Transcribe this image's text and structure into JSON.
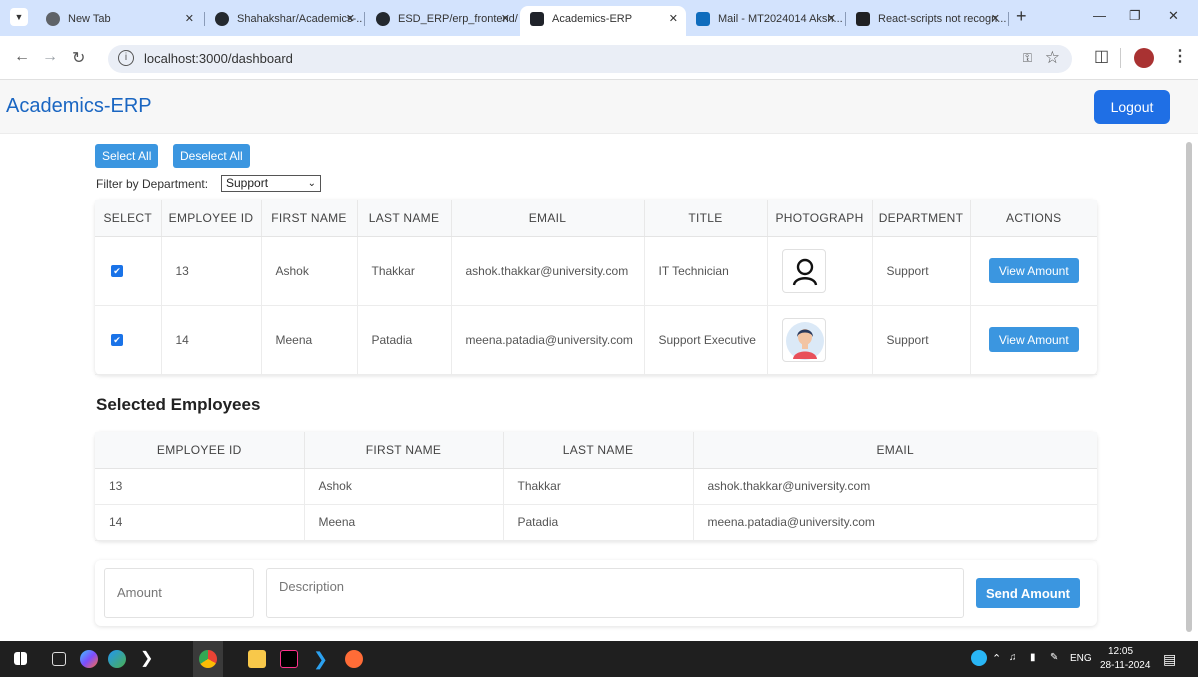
{
  "browser": {
    "tabs": [
      {
        "label": "New Tab",
        "favicon": "chrome-icon"
      },
      {
        "label": "Shahakshar/Academics-...",
        "favicon": "github-icon"
      },
      {
        "label": "ESD_ERP/erp_frontend/...",
        "favicon": "github-icon"
      },
      {
        "label": "Academics-ERP",
        "favicon": "react-icon",
        "active": true
      },
      {
        "label": "Mail - MT2024014 Aksh...",
        "favicon": "outlook-icon"
      },
      {
        "label": "React-scripts not recogn...",
        "favicon": "openai-icon"
      }
    ],
    "url": "localhost:3000/dashboard"
  },
  "app": {
    "title": "Academics-ERP",
    "logout_label": "Logout",
    "select_all_label": "Select All",
    "deselect_all_label": "Deselect All",
    "filter_label": "Filter by Department:",
    "filter_value": "Support",
    "employees_table": {
      "columns": [
        "SELECT",
        "EMPLOYEE ID",
        "FIRST NAME",
        "LAST NAME",
        "EMAIL",
        "TITLE",
        "PHOTOGRAPH",
        "DEPARTMENT",
        "ACTIONS"
      ],
      "rows": [
        {
          "selected": true,
          "employee_id": "13",
          "first_name": "Ashok",
          "last_name": "Thakkar",
          "email": "ashok.thakkar@university.com",
          "title": "IT Technician",
          "photo": "person-outline-icon",
          "department": "Support",
          "action_label": "View Amount"
        },
        {
          "selected": true,
          "employee_id": "14",
          "first_name": "Meena",
          "last_name": "Patadia",
          "email": "meena.patadia@university.com",
          "title": "Support Executive",
          "photo": "woman-avatar-icon",
          "department": "Support",
          "action_label": "View Amount"
        }
      ]
    },
    "selected_section_title": "Selected Employees",
    "selected_table": {
      "columns": [
        "EMPLOYEE ID",
        "FIRST NAME",
        "LAST NAME",
        "EMAIL"
      ],
      "rows": [
        {
          "employee_id": "13",
          "first_name": "Ashok",
          "last_name": "Thakkar",
          "email": "ashok.thakkar@university.com"
        },
        {
          "employee_id": "14",
          "first_name": "Meena",
          "last_name": "Patadia",
          "email": "meena.patadia@university.com"
        }
      ]
    },
    "amount_placeholder": "Amount",
    "description_placeholder": "Description",
    "send_label": "Send Amount"
  },
  "taskbar": {
    "time": "12:05",
    "date": "28-11-2024",
    "lang": "ENG"
  },
  "colors": {
    "accent": "#3b96e0",
    "logout": "#1f6fe5",
    "title": "#1a66c2",
    "tabstrip": "#d3e3fd"
  }
}
